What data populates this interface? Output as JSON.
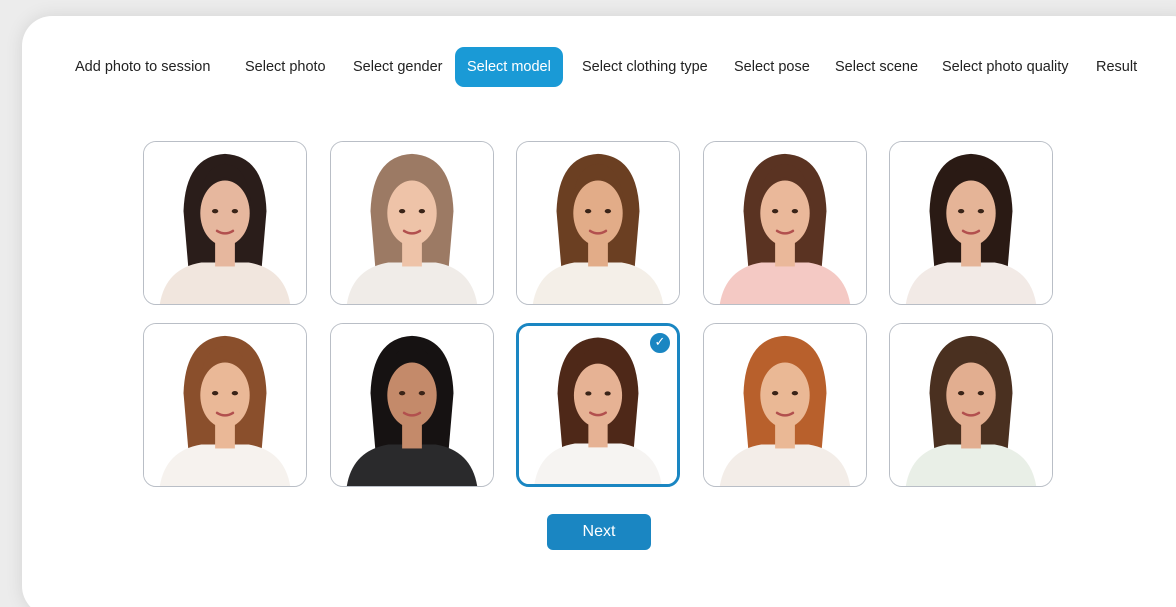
{
  "steps": [
    {
      "label": "Add photo to session",
      "active": false
    },
    {
      "label": "Select photo",
      "active": false
    },
    {
      "label": "Select gender",
      "active": false
    },
    {
      "label": "Select model",
      "active": true
    },
    {
      "label": "Select clothing type",
      "active": false
    },
    {
      "label": "Select pose",
      "active": false
    },
    {
      "label": "Select scene",
      "active": false
    },
    {
      "label": "Select photo quality",
      "active": false
    },
    {
      "label": "Result",
      "active": false
    }
  ],
  "models": [
    {
      "hair": "#2a1d1a",
      "skin": "#e6b79e",
      "top": "#f1e6de",
      "selected": false
    },
    {
      "hair": "#9c7a64",
      "skin": "#eec3a8",
      "top": "#f0ece8",
      "selected": false
    },
    {
      "hair": "#6b3f22",
      "skin": "#e2ac88",
      "top": "#f4efe8",
      "selected": false
    },
    {
      "hair": "#5a3322",
      "skin": "#eab89a",
      "top": "#f4c9c4",
      "selected": false
    },
    {
      "hair": "#2a1a14",
      "skin": "#e5b497",
      "top": "#f2eae6",
      "selected": false
    },
    {
      "hair": "#8a4f2c",
      "skin": "#eab897",
      "top": "#f6f2ee",
      "selected": false
    },
    {
      "hair": "#161212",
      "skin": "#c48a6a",
      "top": "#2a2a2c",
      "selected": false
    },
    {
      "hair": "#4e2818",
      "skin": "#e6b294",
      "top": "#f6f4f2",
      "selected": true
    },
    {
      "hair": "#b8602c",
      "skin": "#eab895",
      "top": "#f3ede8",
      "selected": false
    },
    {
      "hair": "#4a3020",
      "skin": "#e2ae90",
      "top": "#e9efe7",
      "selected": false
    }
  ],
  "next_label": "Next"
}
